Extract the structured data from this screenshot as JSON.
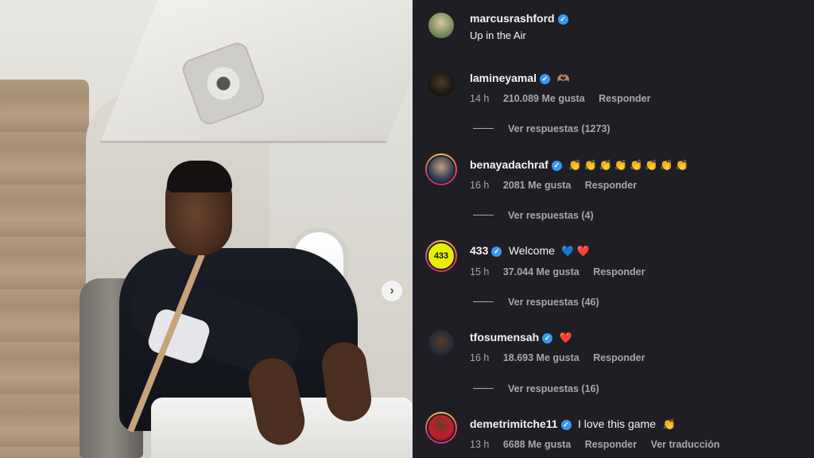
{
  "post": {
    "author": "marcusrashford",
    "caption": "Up in the Air",
    "next_icon": "chevron-right-icon"
  },
  "colors": {
    "panel_bg": "#1e1e24",
    "verified": "#3897f0",
    "meta_text": "#a8a8a8"
  },
  "comments": [
    {
      "username": "lamineyamal",
      "text": "",
      "emoji": "🫶🏽",
      "time": "14 h",
      "likes": "210.089 Me gusta",
      "reply": "Responder",
      "view_replies": "Ver respuestas (1273)"
    },
    {
      "username": "benayadachraf",
      "text": "",
      "emoji": "👏👏👏👏👏👏👏👏",
      "time": "16 h",
      "likes": "2081 Me gusta",
      "reply": "Responder",
      "view_replies": "Ver respuestas (4)"
    },
    {
      "username": "433",
      "text": "Welcome",
      "emoji": "💙❤️",
      "time": "15 h",
      "likes": "37.044 Me gusta",
      "reply": "Responder",
      "view_replies": "Ver respuestas (46)"
    },
    {
      "username": "tfosumensah",
      "text": "",
      "emoji": "❤️",
      "time": "16 h",
      "likes": "18.693 Me gusta",
      "reply": "Responder",
      "view_replies": "Ver respuestas (16)"
    },
    {
      "username": "demetrimitche11",
      "text": "I love this game",
      "emoji": "👏",
      "time": "13 h",
      "likes": "6688 Me gusta",
      "reply": "Responder",
      "translate": "Ver traducción"
    }
  ]
}
